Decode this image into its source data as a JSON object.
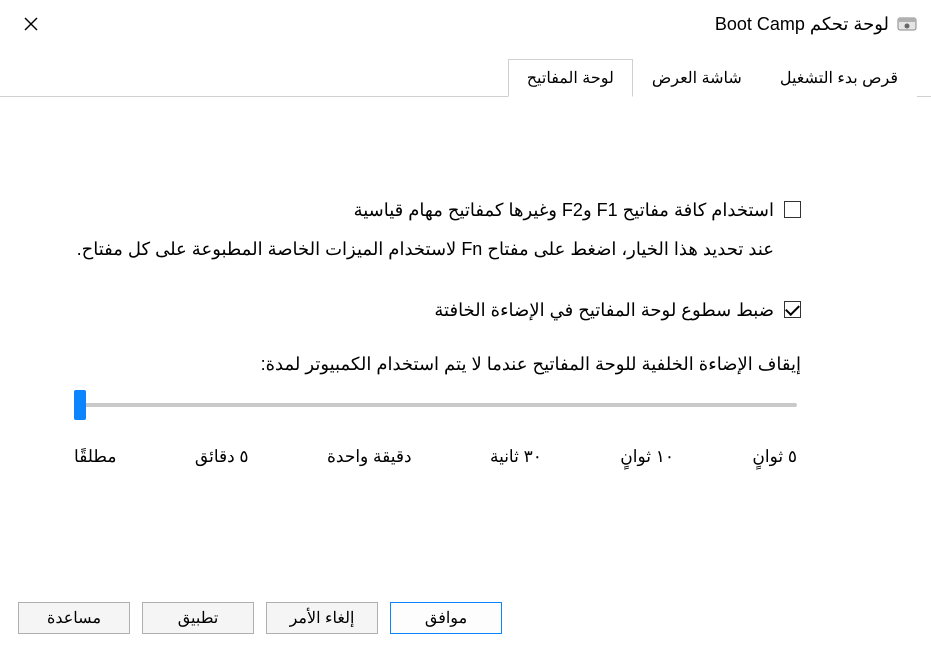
{
  "window": {
    "title": "لوحة تحكم Boot Camp"
  },
  "tabs": [
    {
      "label": "قرص بدء التشغيل",
      "active": false
    },
    {
      "label": "شاشة العرض",
      "active": false
    },
    {
      "label": "لوحة المفاتيح",
      "active": true
    }
  ],
  "keyboard": {
    "fn_option": {
      "label": "استخدام كافة مفاتيح F1 وF2 وغيرها كمفاتيح مهام قياسية",
      "desc": "عند تحديد هذا الخيار، اضغط على مفتاح Fn لاستخدام الميزات الخاصة المطبوعة على كل مفتاح.",
      "checked": false
    },
    "backlight_option": {
      "label": "ضبط سطوع لوحة المفاتيح في الإضاءة الخافتة",
      "checked": true
    },
    "slider": {
      "label": "إيقاف الإضاءة الخلفية للوحة المفاتيح عندما لا يتم استخدام الكمبيوتر لمدة:",
      "value_index": 5,
      "ticks": [
        "٥ ثوانٍ",
        "١٠ ثوانٍ",
        "٣٠ ثانية",
        "دقيقة واحدة",
        "٥ دقائق",
        "مطلقًا"
      ]
    }
  },
  "buttons": {
    "ok": "موافق",
    "cancel": "إلغاء الأمر",
    "apply": "تطبيق",
    "help": "مساعدة"
  }
}
